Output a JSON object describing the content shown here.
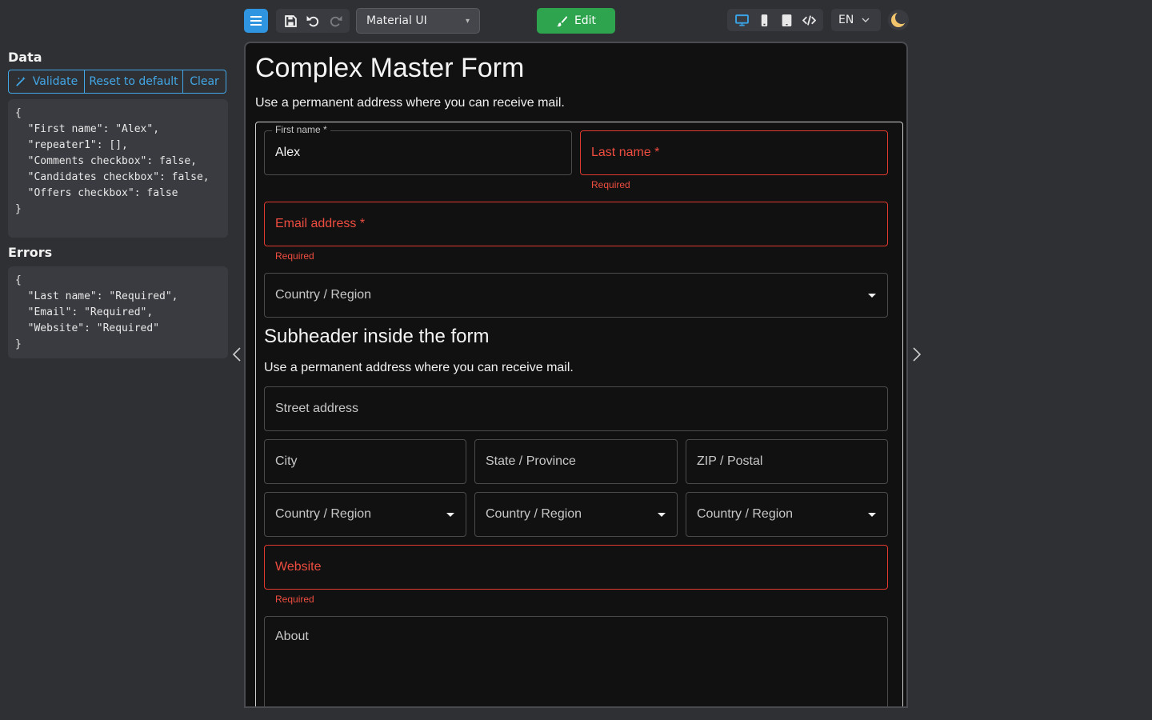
{
  "toolbar": {
    "theme_select_value": "Material UI",
    "edit_label": "Edit",
    "language_value": "EN"
  },
  "left_panel": {
    "data_heading": "Data",
    "validate_label": "Validate",
    "reset_label": "Reset to default",
    "clear_label": "Clear",
    "data_json": "{\n  \"First name\": \"Alex\",\n  \"repeater1\": [],\n  \"Comments checkbox\": false,\n  \"Candidates checkbox\": false,\n  \"Offers checkbox\": false\n}",
    "errors_heading": "Errors",
    "errors_json": "{\n  \"Last name\": \"Required\",\n  \"Email\": \"Required\",\n  \"Website\": \"Required\"\n}"
  },
  "form": {
    "title": "Complex Master Form",
    "description": "Use a permanent address where you can receive mail.",
    "first_name": {
      "label": "First name *",
      "value": "Alex"
    },
    "last_name": {
      "label": "Last name *",
      "helper": "Required"
    },
    "email": {
      "label": "Email address *",
      "helper": "Required"
    },
    "country_region": {
      "label": "Country / Region"
    },
    "subheader": "Subheader inside the form",
    "sub_description": "Use a permanent address where you can receive mail.",
    "street": {
      "label": "Street address"
    },
    "city": {
      "label": "City"
    },
    "state": {
      "label": "State / Province"
    },
    "zip": {
      "label": "ZIP / Postal"
    },
    "country_1": {
      "label": "Country / Region"
    },
    "country_2": {
      "label": "Country / Region"
    },
    "country_3": {
      "label": "Country / Region"
    },
    "website": {
      "label": "Website",
      "helper": "Required"
    },
    "about": {
      "label": "About"
    }
  },
  "colors": {
    "accent": "#2f95e0",
    "edit_green": "#2ea44f",
    "error": "#e03a2f",
    "link_blue": "#42a7e6"
  },
  "icons": [
    "menu-icon",
    "save-icon",
    "undo-icon",
    "redo-icon",
    "brush-icon",
    "desktop-icon",
    "mobile-icon",
    "tablet-icon",
    "code-icon",
    "chevron-down-icon",
    "moon-icon",
    "magic-icon",
    "chevron-left-icon",
    "chevron-right-icon"
  ]
}
